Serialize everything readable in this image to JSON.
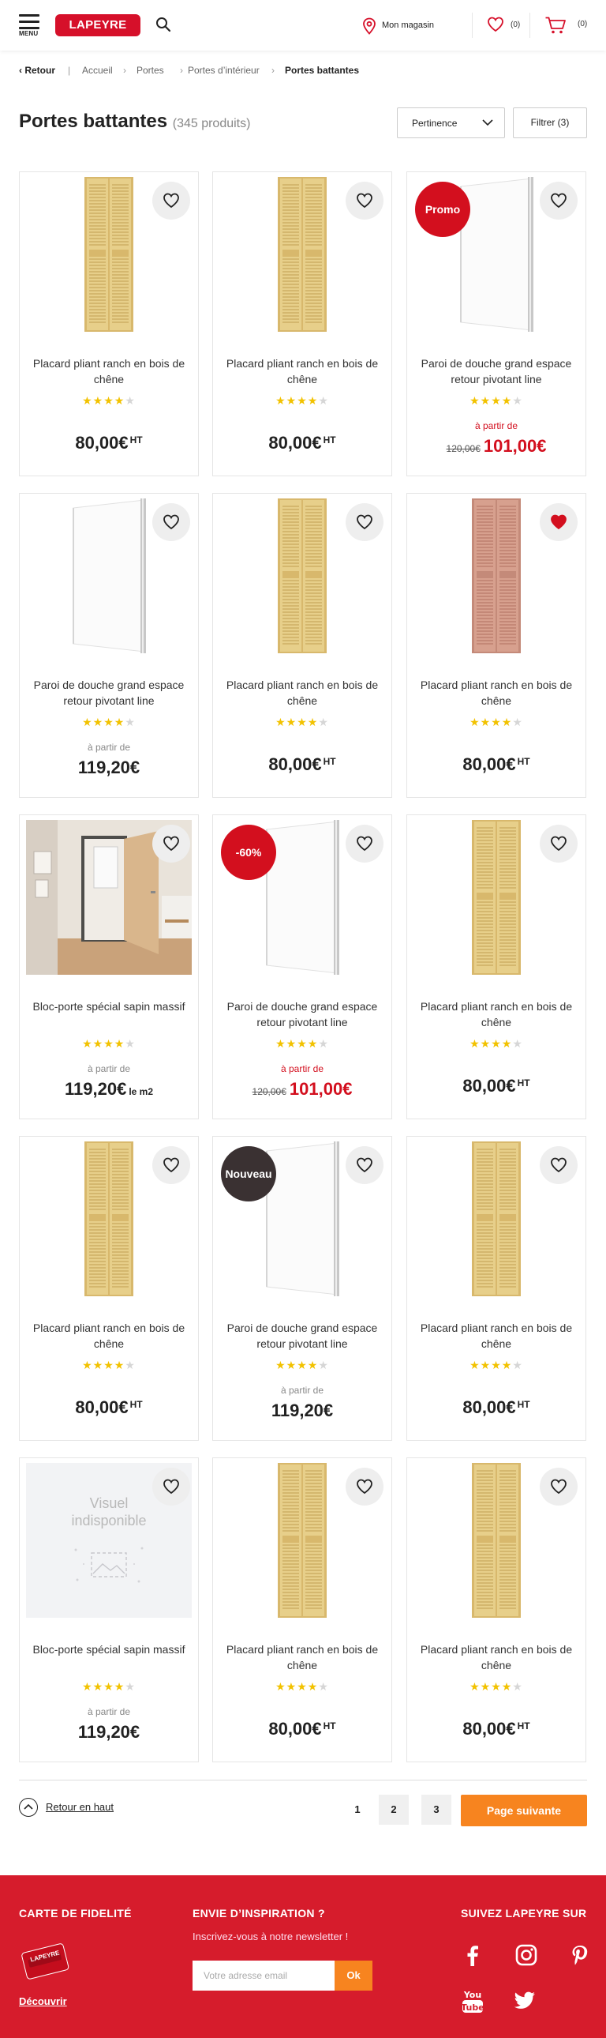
{
  "header": {
    "menu_label": "MENU",
    "logo_text": "LAPEYRE",
    "store_label": "Mon magasin",
    "favorites_count": "(0)",
    "cart_count": "(0)"
  },
  "breadcrumb": {
    "back": "Retour",
    "items": [
      "Accueil",
      "Portes",
      "Portes d’intérieur",
      "Portes battantes"
    ]
  },
  "title": {
    "text": "Portes battantes",
    "count": "(345 produits)"
  },
  "sort": {
    "selected": "Pertinence",
    "icon": "chevron-down-icon"
  },
  "filter": {
    "label": "Filtrer (3)"
  },
  "products": [
    {
      "name": "Placard pliant ranch en bois de chêne",
      "rating": 4,
      "from": "",
      "old_price": "",
      "price": "80,00€",
      "suffix": "HT",
      "badge": "",
      "favorited": false,
      "image": "pine-door",
      "promo": false
    },
    {
      "name": "Placard pliant ranch en bois de chêne",
      "rating": 4,
      "from": "",
      "old_price": "",
      "price": "80,00€",
      "suffix": "HT",
      "badge": "",
      "favorited": false,
      "image": "pine-door",
      "promo": false
    },
    {
      "name": "Paroi de douche grand espace retour pivotant line",
      "rating": 4,
      "from": "à partir de",
      "old_price": "120,00€",
      "price": "101,00€",
      "suffix": "",
      "badge": "Promo",
      "favorited": false,
      "image": "shower-panel",
      "promo": true
    },
    {
      "name": "Paroi de douche grand espace retour pivotant line",
      "rating": 4,
      "from": "à partir de",
      "old_price": "",
      "price": "119,20€",
      "suffix": "",
      "badge": "",
      "favorited": false,
      "image": "shower-panel",
      "promo": false
    },
    {
      "name": "Placard pliant ranch en bois de chêne",
      "rating": 4,
      "from": "",
      "old_price": "",
      "price": "80,00€",
      "suffix": "HT",
      "badge": "",
      "favorited": false,
      "image": "pine-door",
      "promo": false
    },
    {
      "name": "Placard pliant ranch en bois de chêne",
      "rating": 4,
      "from": "",
      "old_price": "",
      "price": "80,00€",
      "suffix": "HT",
      "badge": "",
      "favorited": true,
      "image": "pink-door",
      "promo": false
    },
    {
      "name": "Bloc-porte spécial sapin massif",
      "rating": 4,
      "from": "à partir de",
      "old_price": "",
      "price": "119,20€",
      "unit": "le m2",
      "suffix": "",
      "badge": "",
      "favorited": false,
      "image": "room-photo",
      "promo": false
    },
    {
      "name": "Paroi de douche grand espace retour pivotant line",
      "rating": 4,
      "from": "à partir de",
      "old_price": "120,00€",
      "price": "101,00€",
      "suffix": "",
      "badge": "-60%",
      "favorited": false,
      "image": "shower-panel",
      "promo": true
    },
    {
      "name": "Placard pliant ranch en bois de chêne",
      "rating": 4,
      "from": "",
      "old_price": "",
      "price": "80,00€",
      "suffix": "HT",
      "badge": "",
      "favorited": false,
      "image": "pine-door",
      "promo": false
    },
    {
      "name": "Placard pliant ranch en bois de chêne",
      "rating": 4,
      "from": "",
      "old_price": "",
      "price": "80,00€",
      "suffix": "HT",
      "badge": "",
      "favorited": false,
      "image": "pine-door",
      "promo": false
    },
    {
      "name": "Paroi de douche grand espace retour pivotant line",
      "rating": 4,
      "from": "à partir de",
      "old_price": "",
      "price": "119,20€",
      "suffix": "",
      "badge": "Nouveau",
      "favorited": false,
      "image": "shower-panel",
      "promo": false
    },
    {
      "name": "Placard pliant ranch en bois de chêne",
      "rating": 4,
      "from": "",
      "old_price": "",
      "price": "80,00€",
      "suffix": "HT",
      "badge": "",
      "favorited": false,
      "image": "pine-door",
      "promo": false
    },
    {
      "name": "Bloc-porte spécial sapin massif",
      "rating": 4,
      "from": "à partir de",
      "old_price": "",
      "price": "119,20€",
      "suffix": "",
      "badge": "",
      "favorited": false,
      "image": "placeholder",
      "placeholder_text": "Visuel indisponible",
      "promo": false
    },
    {
      "name": "Placard pliant ranch en bois de chêne",
      "rating": 4,
      "from": "",
      "old_price": "",
      "price": "80,00€",
      "suffix": "HT",
      "badge": "",
      "favorited": false,
      "image": "pine-door",
      "promo": false
    },
    {
      "name": "Placard pliant ranch en bois de chêne",
      "rating": 4,
      "from": "",
      "old_price": "",
      "price": "80,00€",
      "suffix": "HT",
      "badge": "",
      "favorited": false,
      "image": "pine-door",
      "promo": false
    }
  ],
  "pagination": {
    "back_to_top": "Retour en haut",
    "pages": [
      "1",
      "2",
      "3"
    ],
    "current": "1",
    "next": "Page suivante"
  },
  "footer": {
    "loyalty_title": "CARTE DE FIDELITÉ",
    "loyalty_card_text": "LAPEYRE",
    "discover": "Découvrir",
    "newsletter_title": "ENVIE D’INSPIRATION ?",
    "newsletter_sub": "Inscrivez-vous à notre newsletter !",
    "email_placeholder": "Votre adresse email",
    "ok": "Ok",
    "social_title": "SUIVEZ LAPEYRE SUR",
    "social": [
      "facebook-icon",
      "instagram-icon",
      "pinterest-icon",
      "youtube-icon",
      "twitter-icon"
    ]
  },
  "colors": {
    "brand_red": "#d6102a",
    "promo_red": "#d30f1e",
    "orange": "#f7841f",
    "star": "#f2c200",
    "footer_red": "#d61c2c"
  }
}
